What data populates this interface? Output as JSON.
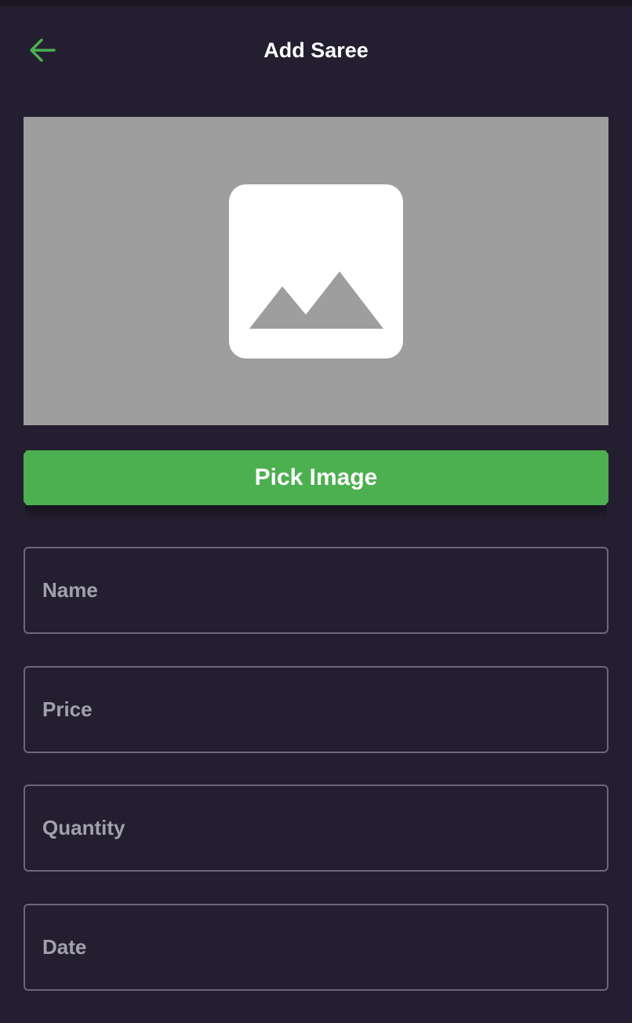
{
  "header": {
    "title": "Add Saree",
    "back_icon": "arrow-left-icon",
    "accent_color": "#4caf50"
  },
  "image_preview": {
    "icon": "image-placeholder-icon",
    "background_color": "#9e9e9e"
  },
  "pick_image_button": {
    "label": "Pick Image",
    "color": "#4caf50"
  },
  "form": {
    "name": {
      "placeholder": "Name",
      "value": ""
    },
    "price": {
      "placeholder": "Price",
      "value": ""
    },
    "quantity": {
      "placeholder": "Quantity",
      "value": ""
    },
    "date": {
      "placeholder": "Date",
      "value": ""
    }
  },
  "theme": {
    "background": "#241f30",
    "field_border": "#6c6778",
    "placeholder_color": "#a3a0ad"
  }
}
